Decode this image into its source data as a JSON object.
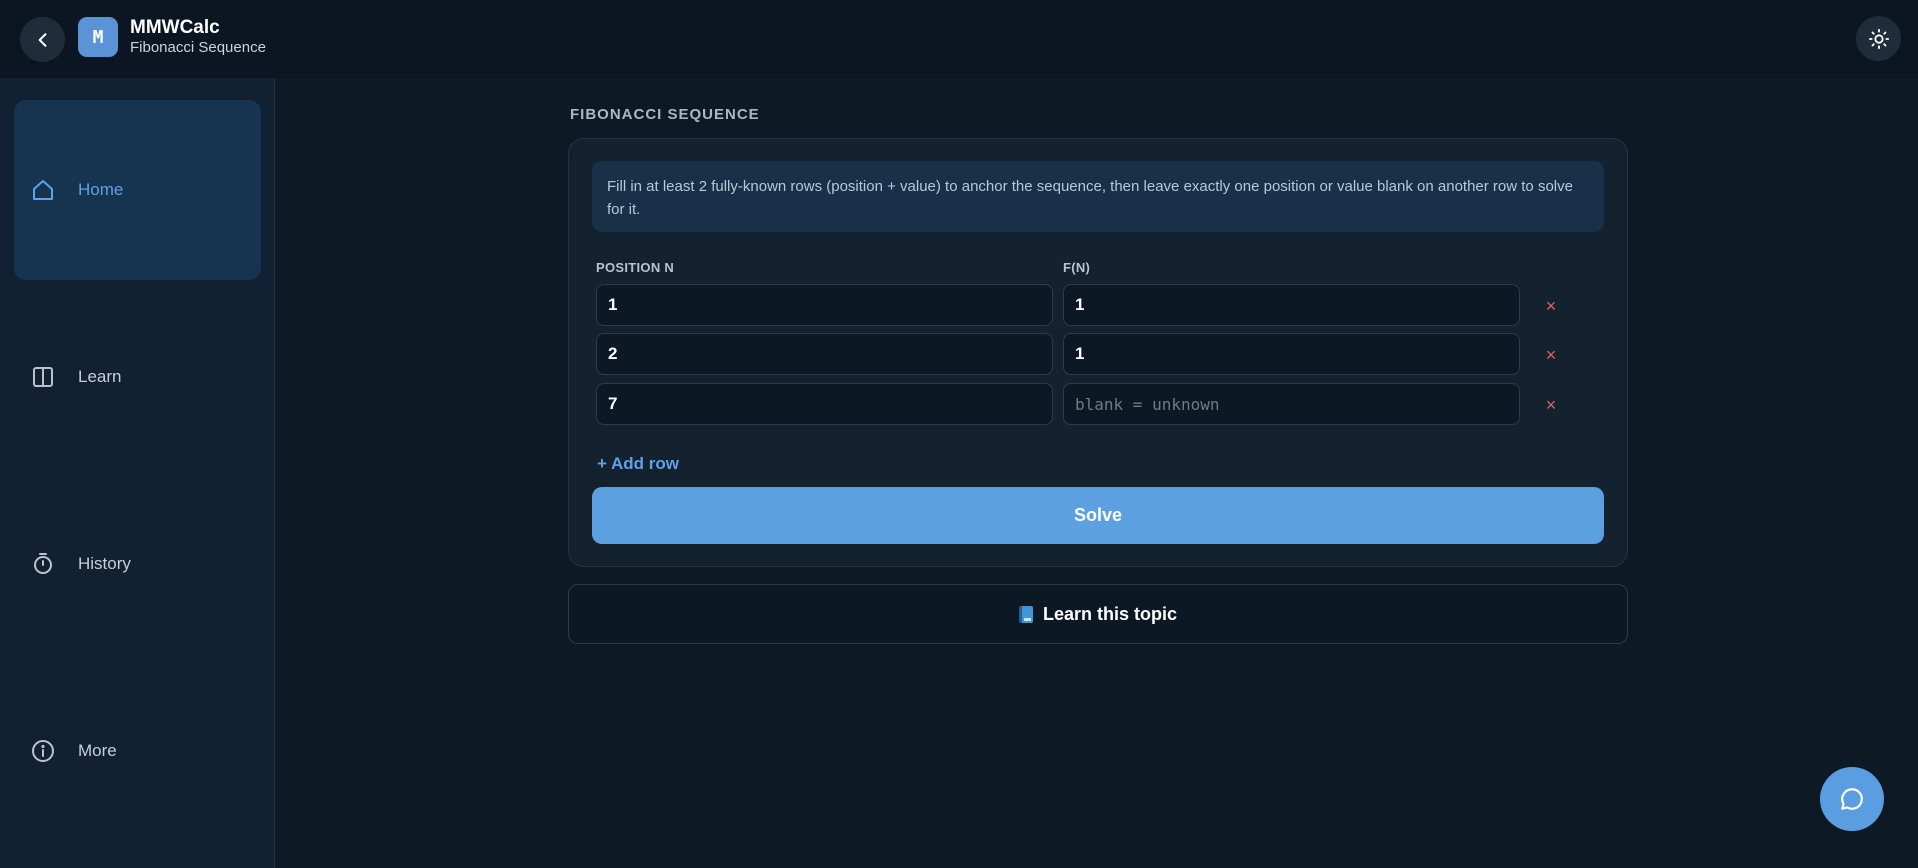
{
  "app": {
    "logo_letter": "M",
    "title": "MMWCalc",
    "subtitle": "Fibonacci Sequence"
  },
  "sidebar": {
    "items": [
      {
        "label": "Home",
        "icon": "home-icon",
        "active": true
      },
      {
        "label": "Learn",
        "icon": "book-open-icon",
        "active": false
      },
      {
        "label": "History",
        "icon": "timer-icon",
        "active": false
      },
      {
        "label": "More",
        "icon": "info-icon",
        "active": false
      }
    ]
  },
  "main": {
    "section_title": "FIBONACCI SEQUENCE",
    "info_text": "Fill in at least 2 fully-known rows (position + value) to anchor the sequence, then leave exactly one position or value blank on another row to solve for it.",
    "columns": {
      "position": "POSITION N",
      "value": "F(N)"
    },
    "rows": [
      {
        "position": "1",
        "value": "1"
      },
      {
        "position": "2",
        "value": "1"
      },
      {
        "position": "7",
        "value": ""
      }
    ],
    "value_placeholder": "blank = unknown",
    "remove_label": "×",
    "add_row_label": "+ Add row",
    "solve_label": "Solve",
    "learn_label": "Learn this topic"
  },
  "colors": {
    "accent": "#5da0e2",
    "background": "#0d1a26",
    "remove": "#e0605c"
  }
}
